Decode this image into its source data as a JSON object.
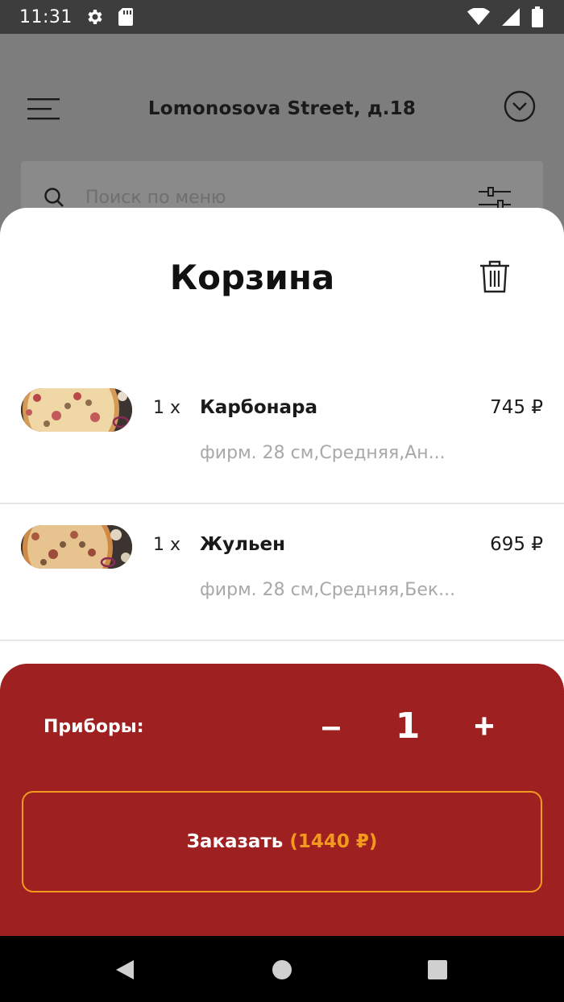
{
  "status_bar": {
    "time": "11:31",
    "icons": [
      "settings-icon",
      "sd-card-icon",
      "wifi-icon",
      "signal-icon",
      "battery-icon"
    ]
  },
  "header": {
    "address": "Lomonosova Street, д.18"
  },
  "search": {
    "placeholder": "Поиск по меню"
  },
  "cart": {
    "title": "Корзина",
    "items": [
      {
        "qty": "1 x",
        "name": "Карбонара",
        "price": "745 ₽",
        "desc": "фирм. 28 см,Средняя,Ан..."
      },
      {
        "qty": "1 x",
        "name": "Жульен",
        "price": "695 ₽",
        "desc": "фирм. 28 см,Средняя,Бек..."
      }
    ]
  },
  "order": {
    "cutlery_label": "Приборы:",
    "minus": "–",
    "count": "1",
    "plus": "+",
    "button_label": "Заказать",
    "button_total": "(1440 ₽)"
  },
  "colors": {
    "accent_red": "#9e2020",
    "accent_orange": "#f39a1d"
  }
}
